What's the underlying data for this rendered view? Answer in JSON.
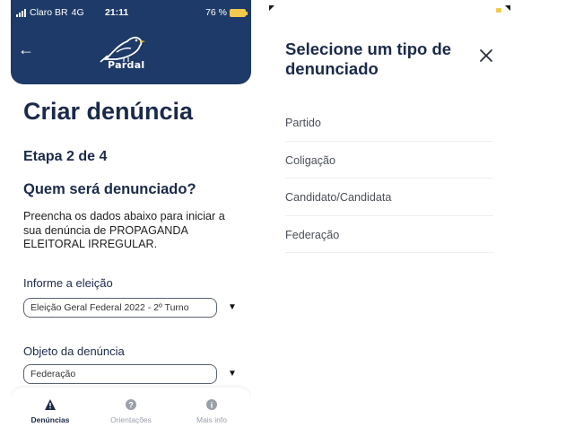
{
  "left_screen": {
    "status_bar": {
      "carrier": "Claro BR",
      "network": "4G",
      "time": "21:11",
      "battery": "76 %"
    },
    "header": {
      "back_icon": "arrow-left-icon",
      "logo_text": "Pardal"
    },
    "title": "Criar denúncia",
    "step": "Etapa 2 de 4",
    "question": "Quem será denunciado?",
    "instructions": "Preencha os dados abaixo para iniciar a sua denúncia de PROPAGANDA ELEITORAL IRREGULAR.",
    "election_field": {
      "label": "Informe a eleição",
      "value": "Eleição Geral Federal 2022 - 2º Turno"
    },
    "object_field": {
      "label": "Objeto da denúncia",
      "value": "Federação"
    },
    "tab_bar": [
      {
        "label": "Denúncias",
        "icon": "warning-icon"
      },
      {
        "label": "Orientações",
        "icon": "question-icon"
      },
      {
        "label": "Mais info",
        "icon": "info-icon"
      }
    ],
    "colors": {
      "header": "#1e3a68",
      "text": "#1b2a4a"
    }
  },
  "right_screen": {
    "modal_title": "Selecione um tipo de denunciado",
    "close_icon": "close-icon",
    "options": [
      "Partido",
      "Coligação",
      "Candidato/Candidata",
      "Federação"
    ]
  }
}
